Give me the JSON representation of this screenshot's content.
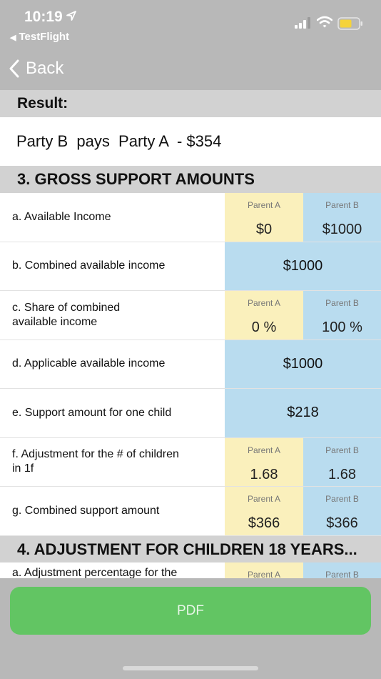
{
  "status_bar": {
    "time": "10:19",
    "back_app": "TestFlight"
  },
  "nav": {
    "back_label": "Back"
  },
  "result": {
    "header": "Result:",
    "text": "Party B  pays  Party A  - $354"
  },
  "section3": {
    "title": "3.  GROSS SUPPORT AMOUNTS",
    "rows": [
      {
        "label": "a.  Available Income",
        "a_caption": "Parent A",
        "a_value": "$0",
        "b_caption": "Parent B",
        "b_value": "$1000"
      },
      {
        "label": "b.  Combined available income",
        "combined": "$1000"
      },
      {
        "label": "c.  Share of combined\navailable income",
        "a_caption": "Parent A",
        "a_value": "0 %",
        "b_caption": "Parent B",
        "b_value": "100 %"
      },
      {
        "label": "d.  Applicable available income",
        "combined": "$1000"
      },
      {
        "label": "e.  Support amount for one child",
        "combined": "$218"
      },
      {
        "label": "f.  Adjustment for the # of children\nin 1f",
        "a_caption": "Parent A",
        "a_value": "1.68",
        "b_caption": "Parent B",
        "b_value": "1.68"
      },
      {
        "label": "g.  Combined support amount",
        "a_caption": "Parent A",
        "a_value": "$366",
        "b_caption": "Parent B",
        "b_value": "$366"
      }
    ]
  },
  "section4": {
    "title": "4. ADJUSTMENT FOR CHILDREN 18 YEARS...",
    "first_row": {
      "label": "a.  Adjustment percentage for the",
      "a_caption": "Parent A",
      "b_caption": "Parent B"
    }
  },
  "footer": {
    "pdf_label": "PDF"
  },
  "colors": {
    "parent_a": "#faf0bc",
    "parent_b": "#b9dcef",
    "pdf_button": "#62c563",
    "section_bar": "#d2d2d2",
    "background": "#b8b8b8"
  },
  "icons": [
    "location-arrow-icon",
    "cellular-signal-icon",
    "wifi-icon",
    "battery-icon",
    "chevron-left-icon"
  ]
}
